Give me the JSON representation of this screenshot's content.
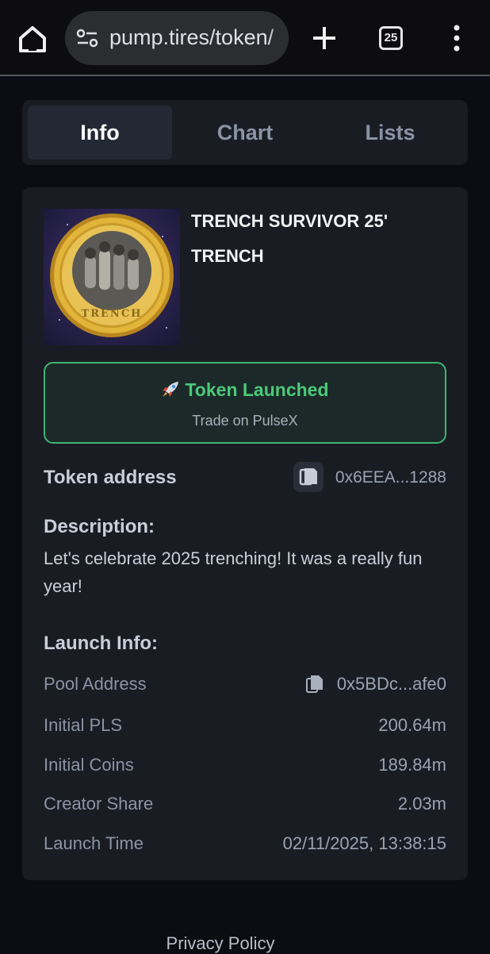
{
  "browser": {
    "url": "pump.tires/token/",
    "tab_count": "25"
  },
  "tabs": [
    {
      "label": "Info",
      "active": true
    },
    {
      "label": "Chart",
      "active": false
    },
    {
      "label": "Lists",
      "active": false
    }
  ],
  "token": {
    "name": "TRENCH SURVIVOR 25'",
    "symbol": "TRENCH",
    "coin_text": "TRENCH",
    "launched_title": "Token Launched",
    "launched_subtitle": "Trade on PulseX",
    "address_label": "Token address",
    "address": "0x6EEA...1288",
    "description_label": "Description:",
    "description": "Let's celebrate 2025 trenching! It was a really fun year!"
  },
  "launch_info": {
    "label": "Launch Info:",
    "rows": [
      {
        "key": "Pool Address",
        "value": "0x5BDc...afe0"
      },
      {
        "key": "Initial PLS",
        "value": "200.64m"
      },
      {
        "key": "Initial Coins",
        "value": "189.84m"
      },
      {
        "key": "Creator Share",
        "value": "2.03m"
      },
      {
        "key": "Launch Time",
        "value": "02/11/2025, 13:38:15"
      }
    ]
  },
  "footer": {
    "privacy_label": "Privacy Policy"
  },
  "colors": {
    "accent_green": "#4cc97a",
    "card_bg": "#1a1c24",
    "page_bg": "#0c0d12"
  }
}
